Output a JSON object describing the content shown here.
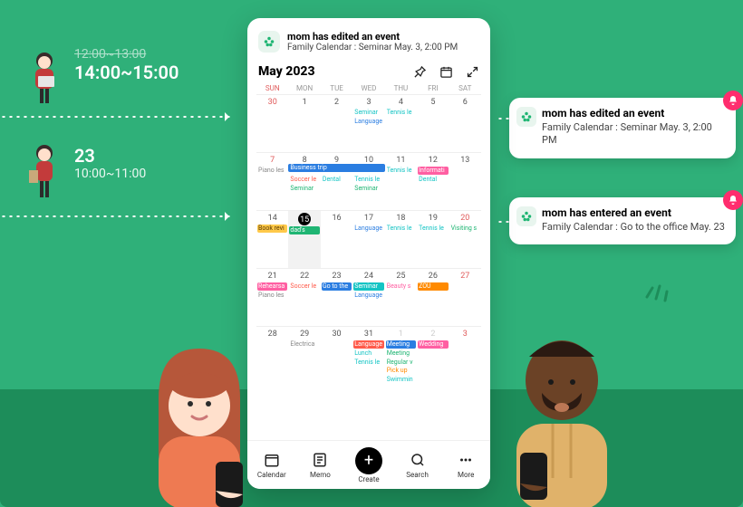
{
  "left_edits": {
    "time_edit": {
      "old": "12:00~13:00",
      "new": "14:00~15:00"
    },
    "date_edit": {
      "new_day": "23",
      "time": "10:00~11:00"
    }
  },
  "notifications": [
    {
      "title": "mom has edited an event",
      "body": "Family Calendar : Seminar May. 3, 2:00 PM"
    },
    {
      "title": "mom has entered an event",
      "body": "Family Calendar : Go to the office May. 23"
    }
  ],
  "phone": {
    "toast": {
      "title": "mom has edited an event",
      "body": "Family Calendar : Seminar May. 3, 2:00 PM"
    },
    "month_label": "May 2023",
    "dow": [
      "SUN",
      "MON",
      "TUE",
      "WED",
      "THU",
      "FRI",
      "SAT"
    ],
    "trailing": [
      30,
      1,
      2,
      3,
      4,
      5,
      6
    ],
    "nav": {
      "calendar": "Calendar",
      "memo": "Memo",
      "create": "Create",
      "search": "Search",
      "more": "More"
    }
  },
  "events": {
    "w1": {
      "seminar": "Seminar",
      "tennis": "Tennis le",
      "language": "Language"
    },
    "w2": {
      "piano": "Piano les",
      "business": "Business trip",
      "soccer": "Soccer le",
      "dental1": "Dental",
      "tennis": "Tennis le",
      "seminar": "Seminar",
      "seminar2": "Seminar",
      "informat": "Informati",
      "dental2": "Dental"
    },
    "w3": {
      "book": "Book revi",
      "dads": "dad's",
      "language": "Language",
      "tennis": "Tennis le",
      "tennis2": "Tennis le",
      "visiting": "Visiting s"
    },
    "w4": {
      "rehearsa": "Rehearsa",
      "pianoles": "Piano les",
      "soccer": "Soccer le",
      "goto": "Go to the",
      "seminar": "Seminar",
      "language": "Language",
      "beauty": "Beauty s",
      "zou": "ZOU"
    },
    "w5": {
      "electrica": "Electrica",
      "language": "Language",
      "meeting": "Meeting",
      "lunch": "Lunch",
      "tennis": "Tennis le",
      "wedding": "Wedding",
      "meeting2": "Meeting",
      "regular": "Regular v",
      "pickup": "Pick up",
      "swimmin": "Swimmin"
    }
  },
  "colors": {
    "cyan": "#14c4c4",
    "blue": "#2a7de1",
    "yellow": "#ffc94a",
    "pink": "#ff5fa2",
    "red": "#ff5a4a",
    "green": "#1fb573",
    "orange": "#ff8a00",
    "grey": "#888"
  }
}
